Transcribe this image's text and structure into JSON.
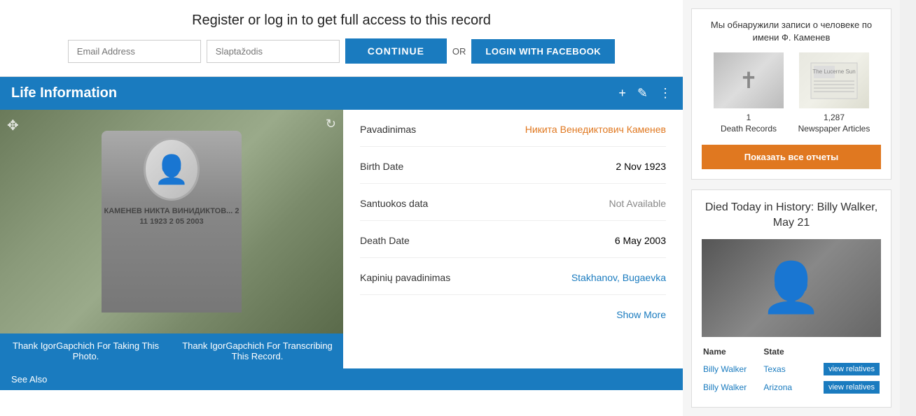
{
  "register": {
    "title": "Register or log in to get full access to this record",
    "email_placeholder": "Email Address",
    "password_placeholder": "Slaptažodis",
    "continue_label": "CONTINUE",
    "or_label": "OR",
    "facebook_label": "LOGIN WITH FACEBOOK"
  },
  "life_info": {
    "section_title": "Life Information",
    "fields": [
      {
        "label": "Pavadinimas",
        "value": "Никита Венедиктович Каменев",
        "type": "orange"
      },
      {
        "label": "Birth Date",
        "value": "2 Nov 1923",
        "type": "normal"
      },
      {
        "label": "Santuokos data",
        "value": "Not Available",
        "type": "gray"
      },
      {
        "label": "Death Date",
        "value": "6 May 2003",
        "type": "normal"
      },
      {
        "label": "Kapinių pavadinimas",
        "value": "Stakhanov, Bugaevka",
        "type": "blue"
      }
    ],
    "show_more": "Show More",
    "thank_photo": "Thank IgorGapchich For Taking This Photo.",
    "thank_transcribe": "Thank IgorGapchich For Transcribing This Record.",
    "grave_text": "КАМЕНЕВ\nНИКТА\nВИНИДИКТОВ...\n2 11 1923\n2 05 2003"
  },
  "see_also": {
    "label": "See Also"
  },
  "sidebar": {
    "records_title": "Мы обнаружили записи о человеке по имени Ф. Каменев",
    "record_items": [
      {
        "count": "1",
        "label": "Death Records",
        "type": "death"
      },
      {
        "count": "1,287",
        "label": "Newspaper Articles",
        "type": "newspaper"
      }
    ],
    "show_reports_btn": "Показать все отчеты",
    "died_today_title": "Died Today in History: Billy Walker, May 21",
    "table_headers": {
      "name": "Name",
      "state": "State"
    },
    "people": [
      {
        "name": "Billy Walker",
        "state": "Texas",
        "action": "view relatives"
      },
      {
        "name": "Billy Walker",
        "state": "Arizona",
        "action": "view relatives"
      }
    ]
  },
  "icons": {
    "plus": "+",
    "edit": "✎",
    "more": "⋮",
    "move": "✥",
    "refresh": "↻",
    "cross": "✝"
  }
}
